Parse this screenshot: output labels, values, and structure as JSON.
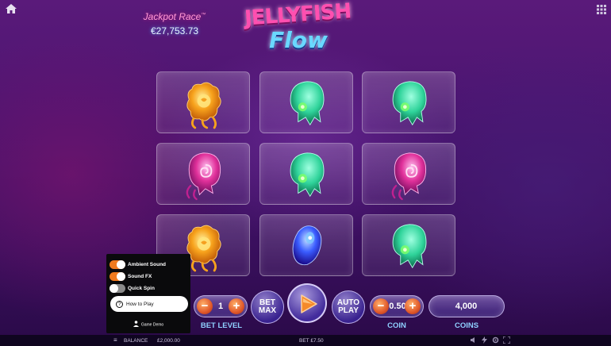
{
  "header": {
    "jackpot_title": "Jackpot Race",
    "jackpot_tm": "™",
    "jackpot_value": "€27,753.73",
    "logo_line1": "JELLYFISH",
    "logo_line2": "Flow"
  },
  "reels": [
    [
      "orange-jellyfish",
      "green-jellyfish",
      "green-jellyfish"
    ],
    [
      "pink-jellyfish",
      "green-jellyfish",
      "pink-jellyfish"
    ],
    [
      "orange-jellyfish",
      "blue-jellyfish",
      "green-jellyfish"
    ]
  ],
  "symbol_colors": {
    "orange-jellyfish": "#f7a21c",
    "green-jellyfish": "#2fd39a",
    "pink-jellyfish": "#e0309a",
    "blue-jellyfish": "#3a5cff"
  },
  "settings_menu": {
    "toggles": [
      {
        "label": "Ambient Sound",
        "on": true
      },
      {
        "label": "Sound FX",
        "on": true
      },
      {
        "label": "Quick Spin",
        "on": false
      }
    ],
    "how_to_play": "How to Play",
    "game_demo": "Game Demo"
  },
  "controls": {
    "bet_level_value": "1",
    "bet_level_label": "BET LEVEL",
    "bet_max_label_1": "BET",
    "bet_max_label_2": "MAX",
    "auto_play_label_1": "AUTO",
    "auto_play_label_2": "PLAY",
    "coin_value": "0.50",
    "coin_label": "COIN",
    "coins_value": "4,000",
    "coins_label": "COINS",
    "minus": "−",
    "plus": "+"
  },
  "bottom_bar": {
    "menu_icon": "≡",
    "balance_label": "BALANCE",
    "balance_value": "£2,000.00",
    "bet_text": "BET £7.50"
  },
  "colors": {
    "accent_orange": "#f07a1e",
    "label_blue": "#8fd0ff"
  }
}
